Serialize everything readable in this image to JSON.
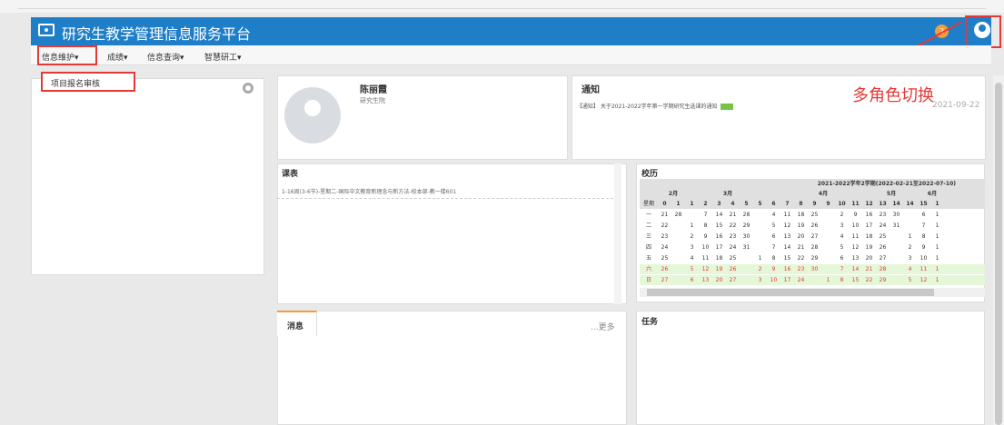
{
  "header": {
    "title": "研究生教学管理信息服务平台",
    "badge": "2",
    "user_icon": "user-icon",
    "color": "#1f7ec8"
  },
  "menu": [
    "信息维护▾",
    "成绩▾",
    "信息查询▾",
    "智慧研工▾"
  ],
  "dropdown_item": "项目报名审核",
  "profile": {
    "name": "陈丽霞",
    "dept": "研究生院"
  },
  "notice": {
    "title": "通知",
    "item": "·【通知】 关于2021-2022学年第一学期研究生选课的通知",
    "date": "2021-09-22"
  },
  "annotation": {
    "text": "多角色切换",
    "color": "#e53935"
  },
  "course": {
    "title": "课表",
    "line": "1-16周(3-6节)-星期二-国际中文教育新理念与新方法-校本部-教一楼601"
  },
  "calendar": {
    "title": "校历",
    "header": {
      "term": "2021-2022学年2学期(2022-02-21至2022-07-10)",
      "months": [
        "2月",
        "3月",
        "4月",
        "5月",
        "6月"
      ],
      "weeks": [
        "0",
        "1",
        "1",
        "2",
        "3",
        "4",
        "5",
        "5",
        "6",
        "7",
        "8",
        "9",
        "9",
        "10",
        "11",
        "12",
        "13",
        "14",
        "14",
        "15",
        "1"
      ]
    },
    "rows": [
      {
        "day": "一",
        "vals": [
          "21",
          "28",
          "",
          "7",
          "14",
          "21",
          "28",
          "",
          "4",
          "11",
          "18",
          "25",
          "",
          "2",
          "9",
          "16",
          "23",
          "30",
          "",
          "6",
          "1"
        ]
      },
      {
        "day": "二",
        "vals": [
          "22",
          "",
          "1",
          "8",
          "15",
          "22",
          "29",
          "",
          "5",
          "12",
          "19",
          "26",
          "",
          "3",
          "10",
          "17",
          "24",
          "31",
          "",
          "7",
          "1"
        ]
      },
      {
        "day": "三",
        "vals": [
          "23",
          "",
          "2",
          "9",
          "16",
          "23",
          "30",
          "",
          "6",
          "13",
          "20",
          "27",
          "",
          "4",
          "11",
          "18",
          "25",
          "",
          "1",
          "8",
          "1"
        ]
      },
      {
        "day": "四",
        "vals": [
          "24",
          "",
          "3",
          "10",
          "17",
          "24",
          "31",
          "",
          "7",
          "14",
          "21",
          "28",
          "",
          "5",
          "12",
          "19",
          "26",
          "",
          "2",
          "9",
          "1"
        ]
      },
      {
        "day": "五",
        "vals": [
          "25",
          "",
          "4",
          "11",
          "18",
          "25",
          "",
          "1",
          "8",
          "15",
          "22",
          "29",
          "",
          "6",
          "13",
          "20",
          "27",
          "",
          "3",
          "10",
          "1"
        ]
      },
      {
        "day": "六",
        "vals": [
          "26",
          "",
          "5",
          "12",
          "19",
          "26",
          "",
          "2",
          "9",
          "16",
          "23",
          "30",
          "",
          "7",
          "14",
          "21",
          "28",
          "",
          "4",
          "11",
          "1"
        ]
      },
      {
        "day": "日",
        "vals": [
          "27",
          "",
          "6",
          "13",
          "20",
          "27",
          "",
          "3",
          "10",
          "17",
          "24",
          "",
          "1",
          "8",
          "15",
          "22",
          "29",
          "",
          "5",
          "12",
          "1"
        ]
      }
    ],
    "week_label": "星期"
  },
  "messages": {
    "tab": "消息",
    "more": "...更多"
  },
  "tasks": {
    "title": "任务"
  }
}
